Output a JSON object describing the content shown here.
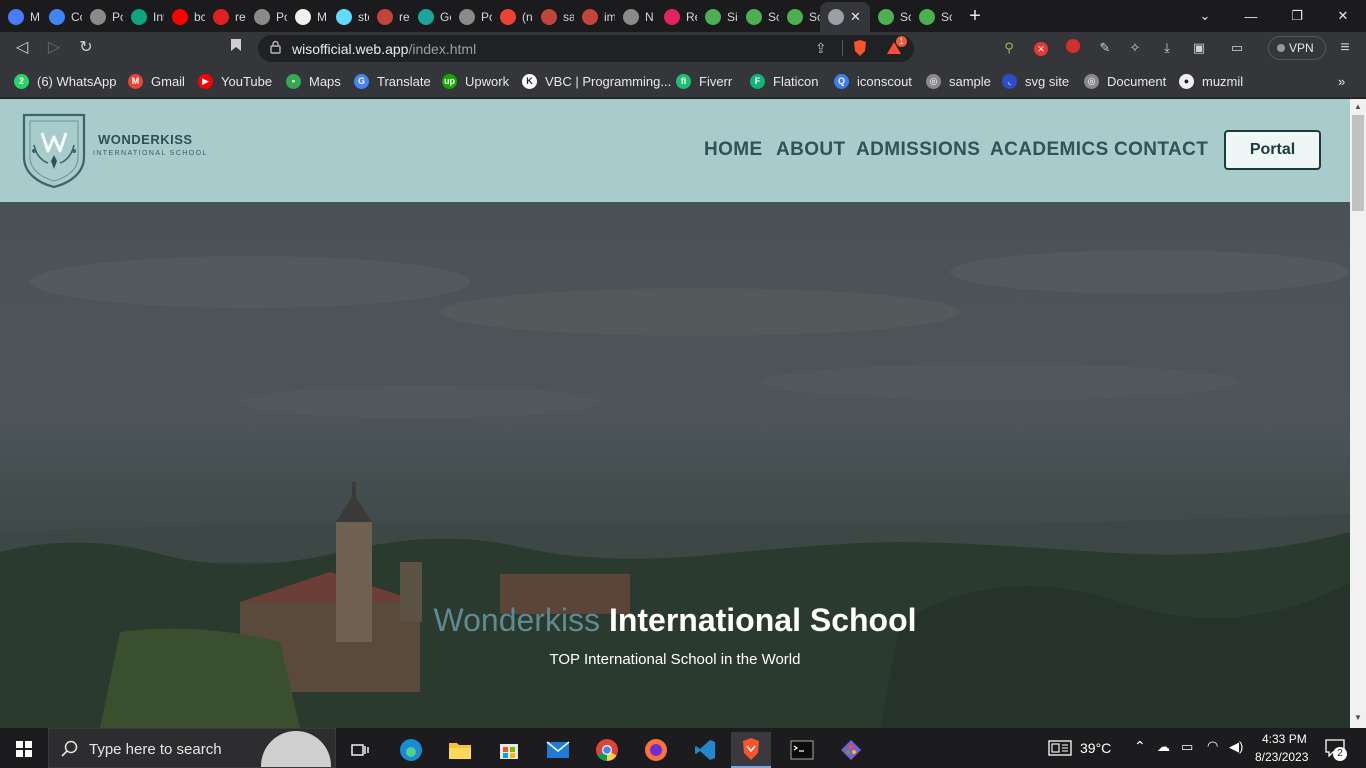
{
  "browser": {
    "tabs": [
      {
        "title": "M",
        "color": "#4a7cff"
      },
      {
        "title": "Cc",
        "color": "#3d86f6"
      },
      {
        "title": "Pc",
        "color": "#8a8a8a"
      },
      {
        "title": "Int",
        "color": "#10a37f"
      },
      {
        "title": "bc",
        "color": "#ff0000"
      },
      {
        "title": "re",
        "color": "#e02020"
      },
      {
        "title": "Pc",
        "color": "#8a8a8a"
      },
      {
        "title": "M",
        "color": "#f0f0f0"
      },
      {
        "title": "ste",
        "color": "#61dafb"
      },
      {
        "title": "re",
        "color": "#c2453b"
      },
      {
        "title": "Ge",
        "color": "#1aa59a"
      },
      {
        "title": "Pc",
        "color": "#8a8a8a"
      },
      {
        "title": "(n",
        "color": "#ea4335"
      },
      {
        "title": "sa",
        "color": "#c2453b"
      },
      {
        "title": "im",
        "color": "#c2453b"
      },
      {
        "title": "N",
        "color": "#8a8a8a"
      },
      {
        "title": "Re",
        "color": "#e0245e"
      },
      {
        "title": "Si",
        "color": "#4caf50"
      },
      {
        "title": "Sc",
        "color": "#4caf50"
      },
      {
        "title": "Sc",
        "color": "#4caf50"
      }
    ],
    "trailing_tabs": [
      {
        "title": "Sc",
        "color": "#4caf50"
      },
      {
        "title": "Sc",
        "color": "#4caf50"
      }
    ],
    "active_tab_close": "✕",
    "new_tab": "+",
    "url_host": "wisofficial.web.app",
    "url_path": "/index.html",
    "vpn_label": "VPN",
    "notification_badge": "1"
  },
  "bookmarks": [
    {
      "label": "(6) WhatsApp",
      "color": "#25d366",
      "glyph": "2"
    },
    {
      "label": "Gmail",
      "color": "#ea4335",
      "glyph": "M"
    },
    {
      "label": "YouTube",
      "color": "#ff0000",
      "glyph": "▶"
    },
    {
      "label": "Maps",
      "color": "#34a853",
      "glyph": "•"
    },
    {
      "label": "Translate",
      "color": "#4285f4",
      "glyph": "G"
    },
    {
      "label": "Upwork",
      "color": "#14a800",
      "glyph": "up"
    },
    {
      "label": "VBC | Programming...",
      "color": "#ffffff",
      "glyph": "K"
    },
    {
      "label": "Fiverr",
      "color": "#1dbf73",
      "glyph": "fi"
    },
    {
      "label": "Flaticon",
      "color": "#0fb47a",
      "glyph": "F"
    },
    {
      "label": "iconscout",
      "color": "#3a7df5",
      "glyph": "Q"
    },
    {
      "label": "sample",
      "color": "#8a8a8a",
      "glyph": "◎"
    },
    {
      "label": "svg site",
      "color": "#2a4dc9",
      "glyph": "◟"
    },
    {
      "label": "Document",
      "color": "#8a8a8a",
      "glyph": "◎"
    },
    {
      "label": "muzmil",
      "color": "#f0f0f0",
      "glyph": "●"
    }
  ],
  "site": {
    "logo_name": "WONDERKISS",
    "logo_sub": "INTERNATIONAL SCHOOL",
    "nav": [
      "HOME",
      "ABOUT",
      "ADMISSIONS",
      "ACADEMICS",
      "CONTACT"
    ],
    "portal_label": "Portal",
    "hero_title_accent": "Wonderkiss",
    "hero_title_rest": "International School",
    "hero_subtitle": "TOP International School in the World"
  },
  "taskbar": {
    "search_placeholder": "Type here to search",
    "weather": "39°C",
    "time": "4:33 PM",
    "date": "8/23/2023",
    "notifications": "2"
  }
}
